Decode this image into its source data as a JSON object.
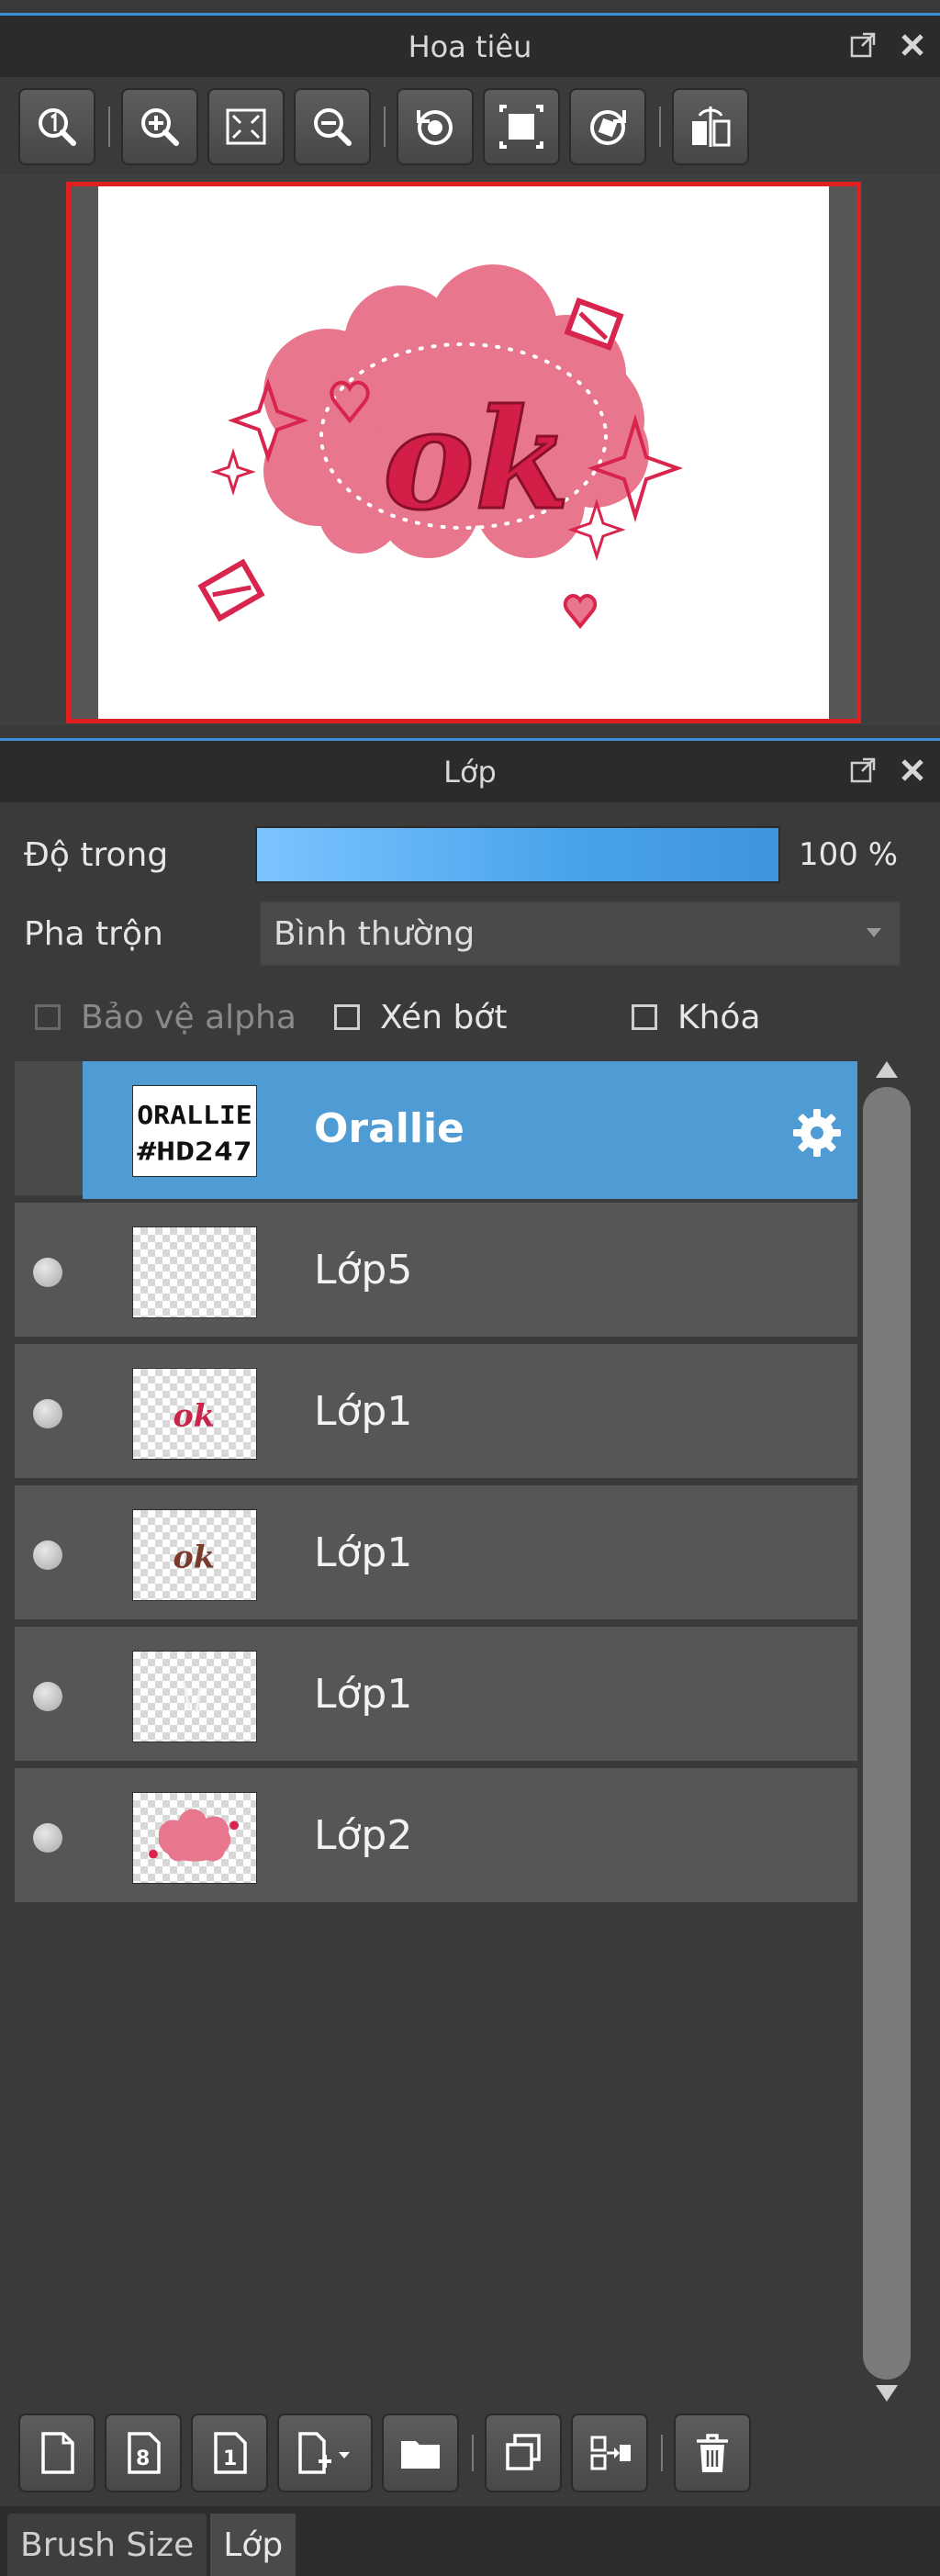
{
  "navigator": {
    "title": "Hoa tiêu",
    "toolbar": [
      "zoom-actual-icon",
      "zoom-in-icon",
      "fit-screen-icon",
      "zoom-out-icon",
      "rotate-left-icon",
      "fit-canvas-icon",
      "rotate-right-icon",
      "flip-icon"
    ],
    "preview_text": "ok"
  },
  "layers_panel": {
    "title": "Lớp",
    "opacity_label": "Độ trong",
    "opacity_value": "100 %",
    "opacity_level": 1.0,
    "blend_label": "Pha trộn",
    "blend_value": "Bình thường",
    "protect_alpha_label": "Bảo vệ alpha",
    "clip_label": "Xén bớt",
    "lock_label": "Khóa",
    "layers": [
      {
        "name": "Orallie",
        "selected": true,
        "thumb": "text",
        "thumb_text_1": "ORALLIE",
        "thumb_text_2": "#HD247"
      },
      {
        "name": "Lớp5",
        "selected": false,
        "thumb": "empty"
      },
      {
        "name": "Lớp1",
        "selected": false,
        "thumb": "ok-pink",
        "thumb_text": "ok"
      },
      {
        "name": "Lớp1",
        "selected": false,
        "thumb": "ok-brown",
        "thumb_text": "ok"
      },
      {
        "name": "Lớp1",
        "selected": false,
        "thumb": "faint"
      },
      {
        "name": "Lớp2",
        "selected": false,
        "thumb": "blob"
      }
    ],
    "bottom_toolbar": [
      "new-layer-icon",
      "new-8bit-layer-icon",
      "new-1bit-layer-icon",
      "add-layer-menu-icon",
      "folder-icon",
      "duplicate-layer-icon",
      "merge-down-icon",
      "delete-layer-icon"
    ]
  },
  "tabs": [
    "Brush Size",
    "Lớp"
  ],
  "colors": {
    "accent": "#3b8fd6",
    "selection": "#4f9bd3",
    "preview_border": "#e02020",
    "blob": "#e86f86"
  }
}
